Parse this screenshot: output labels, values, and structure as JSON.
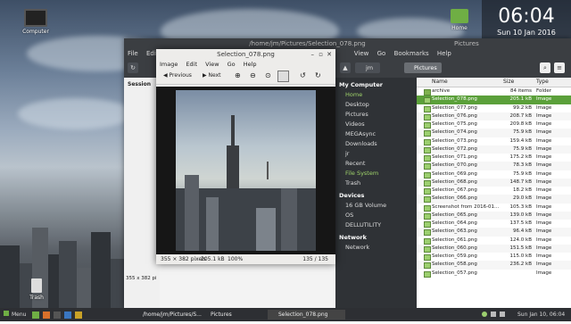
{
  "desktop": {
    "icons": [
      {
        "label": "Computer"
      },
      {
        "label": "Home"
      },
      {
        "label": "Trash"
      }
    ]
  },
  "clock": {
    "time": "06:04",
    "date": "Sun 10 Jan 2016"
  },
  "file_manager": {
    "path_title": "/home/jm/Pictures/Selection_078.png",
    "window_title": "Pictures",
    "menu": [
      "File",
      "Edit",
      "View",
      "Go",
      "Bookmarks",
      "Help"
    ],
    "breadcrumb": [
      "jm",
      "Pictures"
    ],
    "session_label": "Session",
    "status_left": "355 x 382 pi",
    "places": {
      "computer_header": "My Computer",
      "computer_items": [
        "Home",
        "Desktop",
        "Pictures",
        "Videos",
        "MEGAsync",
        "Downloads",
        "jr",
        "Recent",
        "File System",
        "Trash"
      ],
      "devices_header": "Devices",
      "devices_items": [
        "16 GB Volume",
        "OS",
        "DELLUTILITY"
      ],
      "network_header": "Network",
      "network_items": [
        "Network"
      ]
    },
    "columns": {
      "name": "Name",
      "size": "Size",
      "type": "Type"
    },
    "files": [
      {
        "name": "archive",
        "size": "84 items",
        "type": "Folder"
      },
      {
        "name": "Selection_078.png",
        "size": "205.1 kB",
        "type": "Image"
      },
      {
        "name": "Selection_077.png",
        "size": "99.2 kB",
        "type": "Image"
      },
      {
        "name": "Selection_076.png",
        "size": "208.7 kB",
        "type": "Image"
      },
      {
        "name": "Selection_075.png",
        "size": "209.8 kB",
        "type": "Image"
      },
      {
        "name": "Selection_074.png",
        "size": "75.9 kB",
        "type": "Image"
      },
      {
        "name": "Selection_073.png",
        "size": "159.4 kB",
        "type": "Image"
      },
      {
        "name": "Selection_072.png",
        "size": "75.9 kB",
        "type": "Image"
      },
      {
        "name": "Selection_071.png",
        "size": "175.2 kB",
        "type": "Image"
      },
      {
        "name": "Selection_070.png",
        "size": "78.3 kB",
        "type": "Image"
      },
      {
        "name": "Selection_069.png",
        "size": "75.9 kB",
        "type": "Image"
      },
      {
        "name": "Selection_068.png",
        "size": "148.7 kB",
        "type": "Image"
      },
      {
        "name": "Selection_067.png",
        "size": "18.2 kB",
        "type": "Image"
      },
      {
        "name": "Selection_066.png",
        "size": "29.0 kB",
        "type": "Image"
      },
      {
        "name": "Screenshot from 2016-01...",
        "size": "105.3 kB",
        "type": "Image"
      },
      {
        "name": "Selection_065.png",
        "size": "139.0 kB",
        "type": "Image"
      },
      {
        "name": "Selection_064.png",
        "size": "137.5 kB",
        "type": "Image"
      },
      {
        "name": "Selection_063.png",
        "size": "96.4 kB",
        "type": "Image"
      },
      {
        "name": "Selection_061.png",
        "size": "124.0 kB",
        "type": "Image"
      },
      {
        "name": "Selection_060.png",
        "size": "151.5 kB",
        "type": "Image"
      },
      {
        "name": "Selection_059.png",
        "size": "115.0 kB",
        "type": "Image"
      },
      {
        "name": "Selection_058.png",
        "size": "236.2 kB",
        "type": "Image"
      },
      {
        "name": "Selection_057.png",
        "size": "",
        "type": "Image"
      }
    ],
    "selected_index": 1
  },
  "viewer": {
    "title": "Selection_078.png",
    "menu": [
      "Image",
      "Edit",
      "View",
      "Go",
      "Help"
    ],
    "previous_label": "Previous",
    "next_label": "Next",
    "status_dims": "355 × 382 pixels",
    "status_size": "205.1 kB",
    "status_zoom": "100%",
    "status_count": "135 / 135"
  },
  "taskbar": {
    "menu_label": "Menu",
    "windows": [
      {
        "label": "/home/jm/Pictures/S..."
      },
      {
        "label": "Pictures"
      },
      {
        "label": "Selection_078.png"
      }
    ],
    "datetime": "Sun Jan 10, 06:04"
  }
}
